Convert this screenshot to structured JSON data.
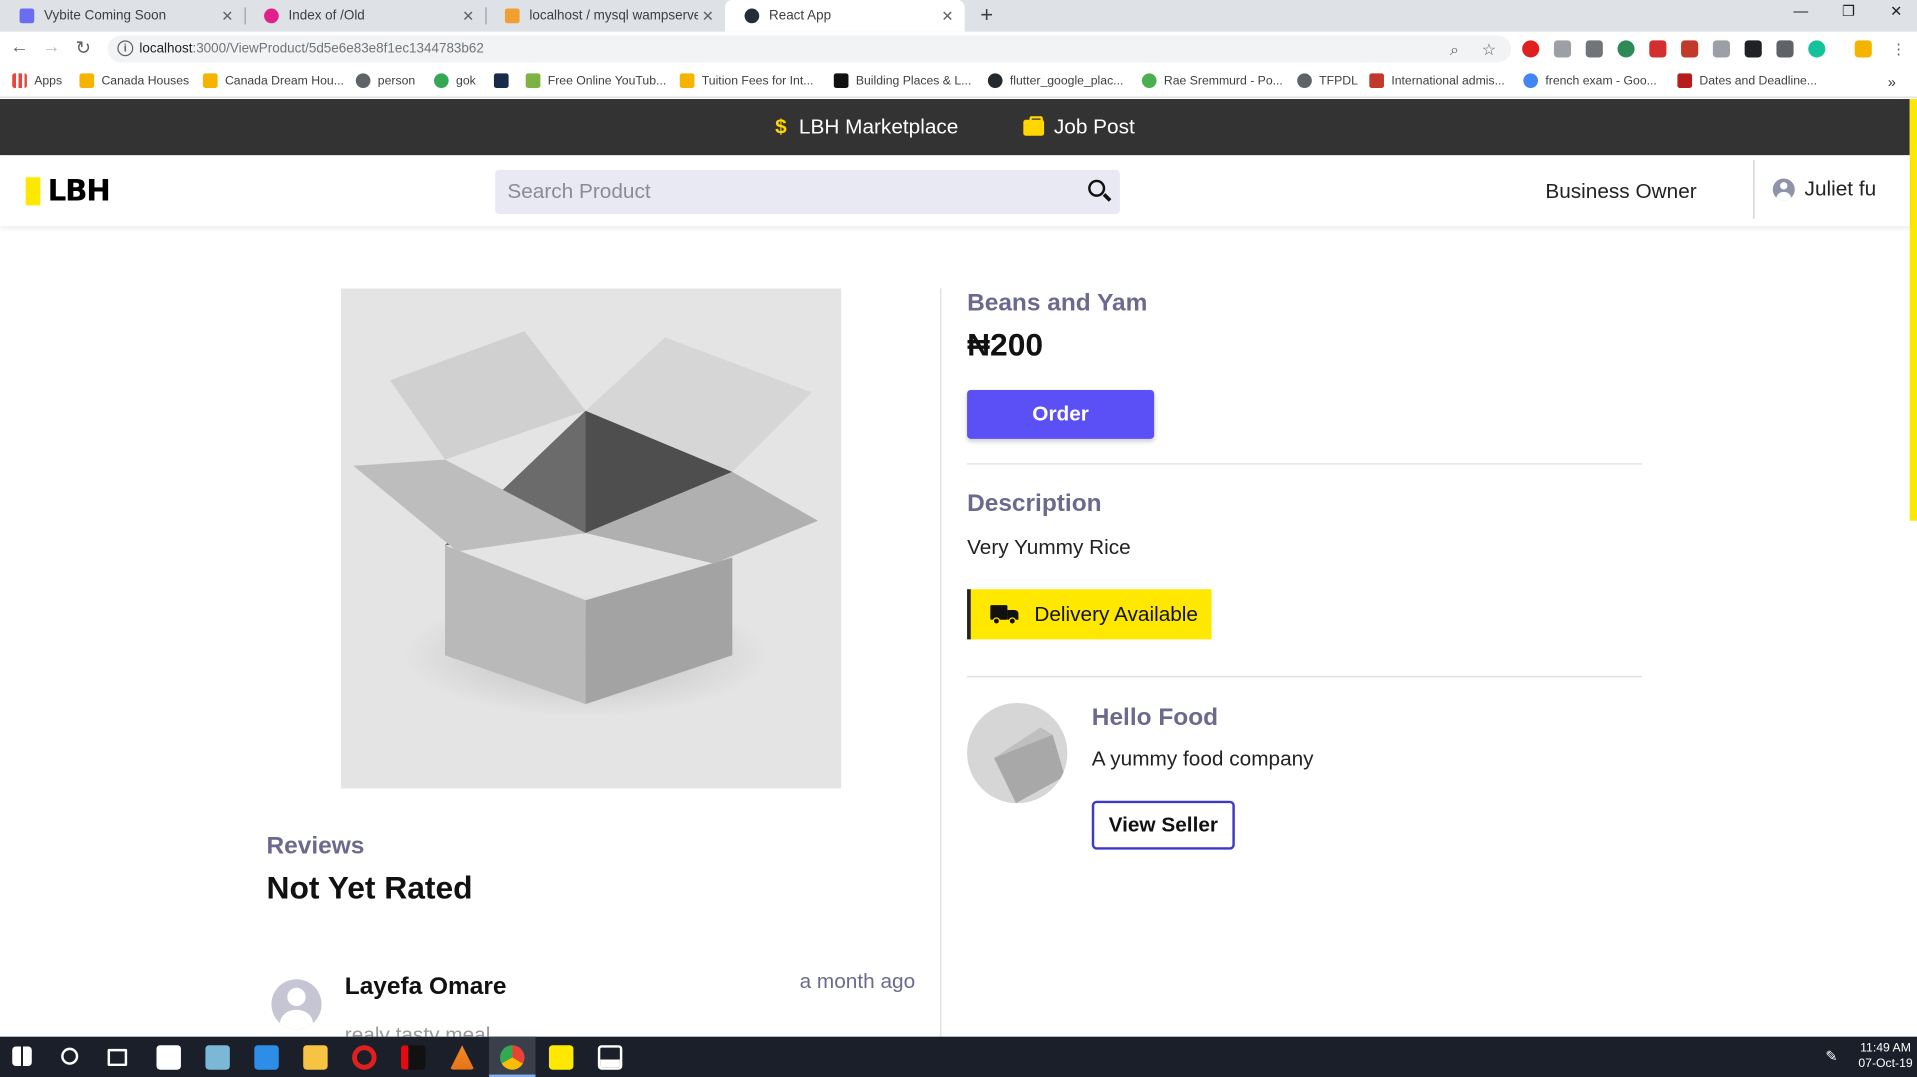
{
  "browser": {
    "tabs": [
      {
        "label": "Vybite Coming Soon",
        "color": "#6c6cf0"
      },
      {
        "label": "Index of /Old",
        "color": "#e0218a"
      },
      {
        "label": "localhost / mysql wampserver / s",
        "color": "#f0a030"
      },
      {
        "label": "React App",
        "color": "#222e3a"
      }
    ],
    "url_host": "localhost",
    "url_path": ":3000/ViewProduct/5d5e6e83e8f1ec1344783b62",
    "bookmarks": [
      "Apps",
      "Canada Houses",
      "Canada Dream Hou...",
      "person",
      "gok",
      "",
      "Free Online YouTub...",
      "Tuition Fees for Int...",
      "Building Places & L...",
      "flutter_google_plac...",
      "Rae Sremmurd - Po...",
      "TFPDL",
      "International admis...",
      "french exam - Goo...",
      "Dates and Deadline..."
    ]
  },
  "topbar": {
    "marketplace": "LBH Marketplace",
    "jobpost": "Job Post"
  },
  "header": {
    "logo": "LBH",
    "search_placeholder": "Search Product",
    "business_owner": "Business Owner",
    "user_name": "Juliet fu"
  },
  "product": {
    "name": "Beans and Yam",
    "price": "₦200",
    "order_label": "Order",
    "description_heading": "Description",
    "description": "Very Yummy Rice",
    "delivery": "Delivery Available"
  },
  "seller": {
    "name": "Hello Food",
    "description": "A yummy food company",
    "view_label": "View Seller"
  },
  "reviews": {
    "heading": "Reviews",
    "status": "Not Yet Rated",
    "items": [
      {
        "author": "Layefa Omare",
        "time": "a month ago",
        "text": "realy tasty meal"
      }
    ]
  },
  "taskbar": {
    "time": "11:49 AM",
    "date": "07-Oct-19"
  },
  "colors": {
    "accent": "#5a50f5",
    "yellow": "#ffe800",
    "heading": "#6b6a8e",
    "topbar": "#333333"
  }
}
